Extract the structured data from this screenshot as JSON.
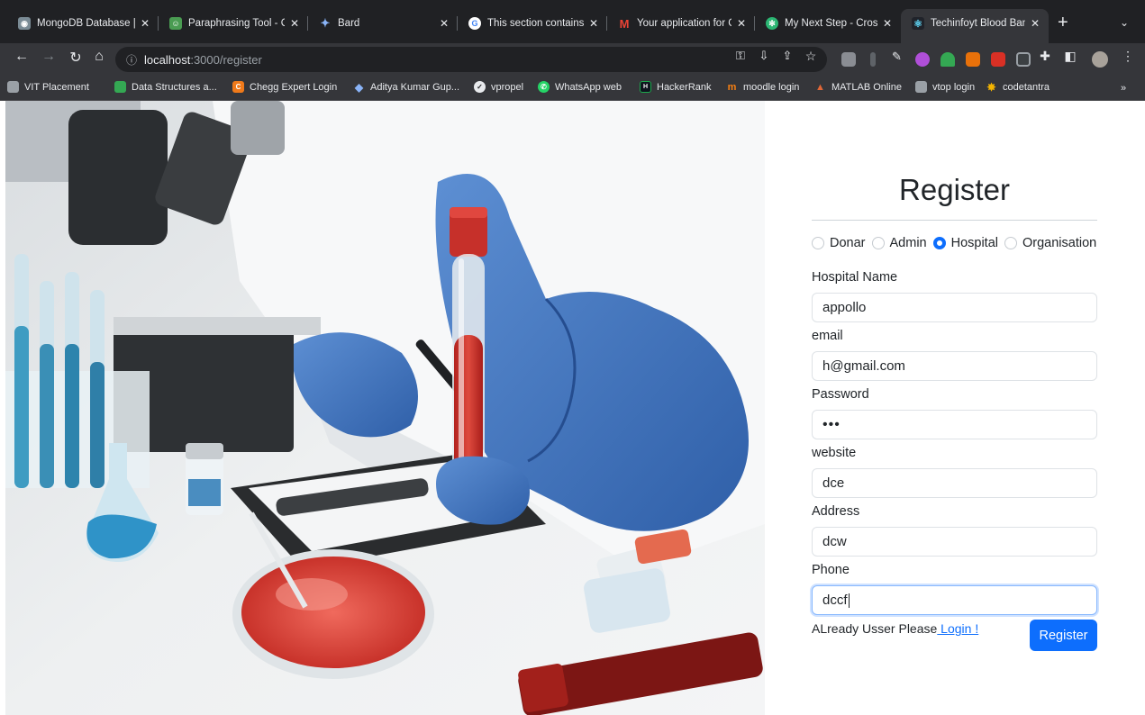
{
  "browser": {
    "tabs": [
      {
        "title": "MongoDB Database |",
        "icon": "mongodb-icon",
        "color": "#7a8b95"
      },
      {
        "title": "Paraphrasing Tool - C",
        "icon": "quillbot-icon",
        "color": "#4a9c52"
      },
      {
        "title": "Bard",
        "icon": "bard-icon",
        "color": "#5b8def"
      },
      {
        "title": "This section contains",
        "icon": "google-icon",
        "color": "#ffffff"
      },
      {
        "title": "Your application for C",
        "icon": "gmail-icon",
        "color": "#ea4335"
      },
      {
        "title": "My Next Step - Cross",
        "icon": "next-step-icon",
        "color": "#2bb673"
      },
      {
        "title": "Techinfoyt Blood Ban",
        "icon": "react-icon",
        "color": "#61dafb"
      }
    ],
    "url_host": "localhost",
    "url_path": ":3000/register",
    "bookmarks": [
      {
        "label": "VIT Placement",
        "icon": "vit-icon",
        "color": "#9aa0a6"
      },
      {
        "label": "Data Structures a...",
        "icon": "ds-icon",
        "color": "#34a853"
      },
      {
        "label": "Chegg Expert Login",
        "icon": "chegg-icon",
        "color": "#f07a1a"
      },
      {
        "label": "Aditya Kumar Gup...",
        "icon": "diamond-icon",
        "color": "#8ab4f8"
      },
      {
        "label": "vpropel",
        "icon": "vpropel-icon",
        "color": "#e8eaed"
      },
      {
        "label": "WhatsApp web",
        "icon": "whatsapp-icon",
        "color": "#25d366"
      },
      {
        "label": "HackerRank",
        "icon": "hackerrank-icon",
        "color": "#1ba94c"
      },
      {
        "label": "moodle login",
        "icon": "moodle-icon",
        "color": "#f98012"
      },
      {
        "label": "MATLAB Online",
        "icon": "matlab-icon",
        "color": "#e16737"
      },
      {
        "label": "vtop login",
        "icon": "vtop-icon",
        "color": "#9aa0a6"
      },
      {
        "label": "codetantra",
        "icon": "codetantra-icon",
        "color": "#f4b400"
      }
    ]
  },
  "form": {
    "title": "Register",
    "roles": [
      {
        "label": "Donar",
        "checked": false
      },
      {
        "label": "Admin",
        "checked": false
      },
      {
        "label": "Hospital",
        "checked": true
      },
      {
        "label": "Organisation",
        "checked": false
      }
    ],
    "fields": [
      {
        "label": "Hospital Name",
        "value": "appollo"
      },
      {
        "label": "email",
        "value": "h@gmail.com"
      },
      {
        "label": "Password",
        "value": "•••"
      },
      {
        "label": "website",
        "value": "dce"
      },
      {
        "label": "Address",
        "value": "dcw"
      },
      {
        "label": "Phone",
        "value": "dccf"
      }
    ],
    "already_text": "ALready Usser Please",
    "login_link": " Login !",
    "submit_label": "Register",
    "accent": "#0d6efd"
  }
}
